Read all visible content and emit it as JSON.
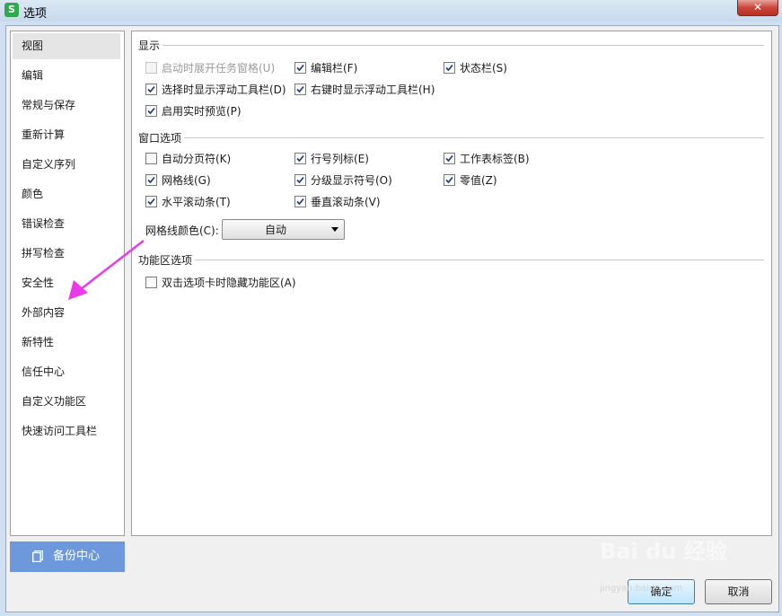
{
  "window": {
    "title": "选项",
    "app_icon_letter": "S",
    "close_symbol": "✕"
  },
  "sidebar": {
    "items": [
      {
        "label": "视图",
        "active": true
      },
      {
        "label": "编辑"
      },
      {
        "label": "常规与保存"
      },
      {
        "label": "重新计算"
      },
      {
        "label": "自定义序列"
      },
      {
        "label": "颜色"
      },
      {
        "label": "错误检查"
      },
      {
        "label": "拼写检查"
      },
      {
        "label": "安全性"
      },
      {
        "label": "外部内容"
      },
      {
        "label": "新特性"
      },
      {
        "label": "信任中心"
      },
      {
        "label": "自定义功能区"
      },
      {
        "label": "快速访问工具栏"
      }
    ],
    "backup_label": "备份中心"
  },
  "display": {
    "title": "显示",
    "options": [
      {
        "label": "启动时展开任务窗格(U)",
        "checked": false,
        "disabled": true
      },
      {
        "label": "编辑栏(F)",
        "checked": true
      },
      {
        "label": "状态栏(S)",
        "checked": true
      },
      {
        "label": "选择时显示浮动工具栏(D)",
        "checked": true
      },
      {
        "label": "右键时显示浮动工具栏(H)",
        "checked": true
      },
      {
        "label": "启用实时预览(P)",
        "checked": true
      }
    ]
  },
  "window_options": {
    "title": "窗口选项",
    "options": [
      {
        "label": "自动分页符(K)",
        "checked": false
      },
      {
        "label": "行号列标(E)",
        "checked": true
      },
      {
        "label": "工作表标签(B)",
        "checked": true
      },
      {
        "label": "网格线(G)",
        "checked": true
      },
      {
        "label": "分级显示符号(O)",
        "checked": true
      },
      {
        "label": "零值(Z)",
        "checked": true
      },
      {
        "label": "水平滚动条(T)",
        "checked": true
      },
      {
        "label": "垂直滚动条(V)",
        "checked": true
      }
    ],
    "gridline_color_label": "网格线颜色(C):",
    "gridline_color_value": "自动"
  },
  "ribbon": {
    "title": "功能区选项",
    "options": [
      {
        "label": "双击选项卡时隐藏功能区(A)",
        "checked": false
      }
    ]
  },
  "buttons": {
    "ok": "确定",
    "cancel": "取消"
  },
  "watermark": {
    "text": "Bai du 经验",
    "sub": "jingyan.baidu.com"
  },
  "colors": {
    "accent": "#6d98dc",
    "annotation_arrow": "#e83ae8"
  }
}
